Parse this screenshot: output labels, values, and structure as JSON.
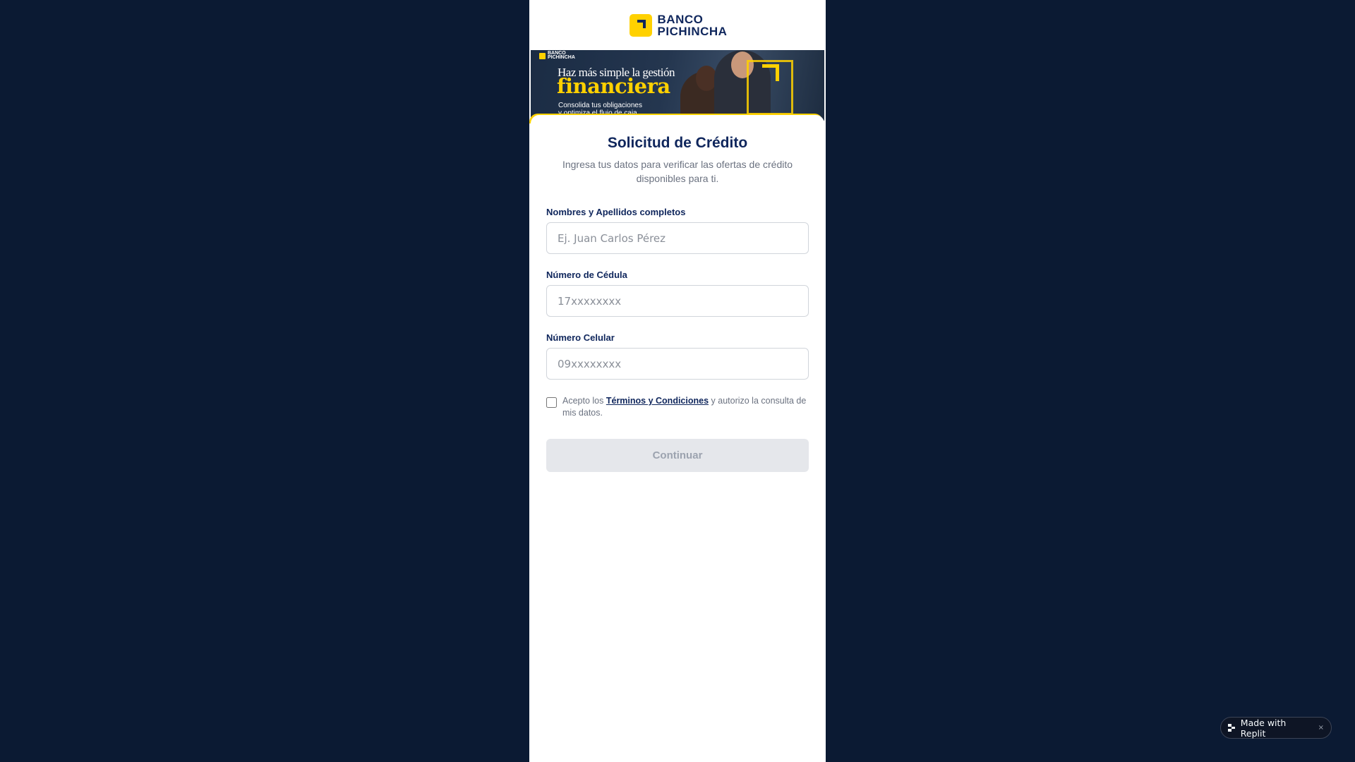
{
  "brand": {
    "name_line1": "BANCO",
    "name_line2": "PICHINCHA",
    "accent_color": "#ffd100",
    "navy_color": "#0f265c",
    "background_color": "#0b1a33"
  },
  "banner": {
    "brand_line1": "BANCO",
    "brand_line2": "PICHINCHA",
    "headline": "Haz más simple la gestión",
    "highlight": "financiera",
    "tagline_line1": "Consolida tus obligaciones",
    "tagline_line2": "y optimiza el flujo de caja"
  },
  "form": {
    "title": "Solicitud de Crédito",
    "subtitle": "Ingresa tus datos para verificar las ofertas de crédito disponibles para ti.",
    "fields": [
      {
        "label": "Nombres y Apellidos completos",
        "placeholder": "Ej. Juan Carlos Pérez",
        "value": ""
      },
      {
        "label": "Número de Cédula",
        "placeholder": "17xxxxxxxx",
        "value": ""
      },
      {
        "label": "Número Celular",
        "placeholder": "09xxxxxxxx",
        "value": ""
      }
    ],
    "terms": {
      "checked": false,
      "prefix": "Acepto los",
      "link": "Términos y Condiciones",
      "suffix": "y autorizo la consulta de mis datos."
    },
    "continue_label": "Continuar",
    "continue_disabled": true
  },
  "replit_badge": {
    "label": "Made with Replit",
    "close": "×",
    "icon": "replit-logo-icon"
  }
}
